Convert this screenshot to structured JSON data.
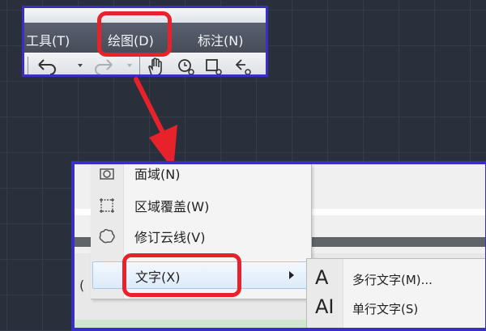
{
  "menubar": {
    "items": [
      {
        "label": "工具(T)"
      },
      {
        "label": "绘图(D)"
      },
      {
        "label": "标注(N)"
      }
    ]
  },
  "toolbar": {
    "icons": [
      "undo-icon",
      "redo-icon",
      "pan-hand-icon",
      "zoom-realtime-icon",
      "zoom-window-icon",
      "zoom-previous-icon"
    ]
  },
  "draw_menu": {
    "items": [
      {
        "label": "面域(N)",
        "icon": "region-icon"
      },
      {
        "label": "区域覆盖(W)",
        "icon": "wipeout-icon"
      },
      {
        "label": "修订云线(V)",
        "icon": "revcloud-icon"
      },
      {
        "label": "文字(X)",
        "icon": "",
        "has_submenu": true
      }
    ]
  },
  "text_submenu": {
    "items": [
      {
        "label": "多行文字(M)...",
        "icon_glyph": "A",
        "icon": "mtext-icon"
      },
      {
        "label": "单行文字(S)",
        "icon_glyph": "AI",
        "icon": "single-line-text-icon"
      }
    ]
  },
  "misc": {
    "paren": "("
  },
  "colors": {
    "highlight": "#e8222b",
    "inset_border": "#3a2fc4",
    "canvas": "#2a303b"
  }
}
